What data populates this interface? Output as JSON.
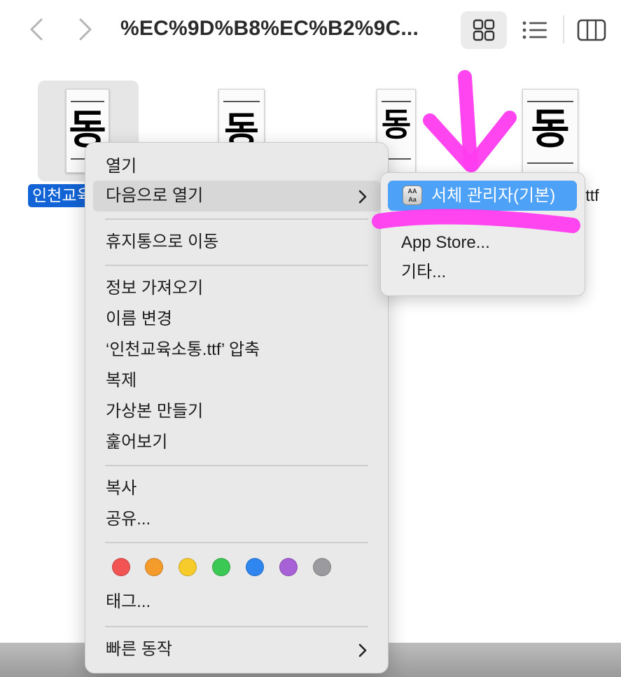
{
  "toolbar": {
    "title": "%EC%9D%B8%EC%B2%9C...",
    "back_icon": "chevron-left-icon",
    "forward_icon": "chevron-right-icon",
    "views": [
      "grid-view-icon",
      "list-view-icon",
      "column-view-icon"
    ]
  },
  "files": [
    {
      "glyph": "동",
      "label": "인천교육",
      "selected": true
    },
    {
      "glyph": "동",
      "label": ""
    },
    {
      "glyph": "동",
      "label": ""
    },
    {
      "glyph": "동",
      "label": ".ttf"
    }
  ],
  "context_menu": {
    "items": {
      "open": "열기",
      "open_with": "다음으로 열기",
      "move_to_trash": "휴지통으로 이동",
      "get_info": "정보 가져오기",
      "rename": "이름 변경",
      "compress": "‘인천교육소통.ttf’ 압축",
      "duplicate": "복제",
      "make_alias": "가상본 만들기",
      "quick_look": "훑어보기",
      "copy": "복사",
      "share": "공유...",
      "tags": "태그...",
      "quick_actions": "빠른 동작"
    },
    "tag_colors": [
      "#f25353",
      "#f49b2c",
      "#f7cc2a",
      "#3cc855",
      "#2f86f0",
      "#a860d6",
      "#9b9b9f"
    ]
  },
  "submenu": {
    "items": {
      "font_book": "서체 관리자(기본)",
      "app_store": "App Store...",
      "other": "기타..."
    }
  },
  "colors": {
    "selection_blue": "#1264d6",
    "highlight_blue": "#4da1f6",
    "annotation_magenta": "#ff3cf0"
  }
}
